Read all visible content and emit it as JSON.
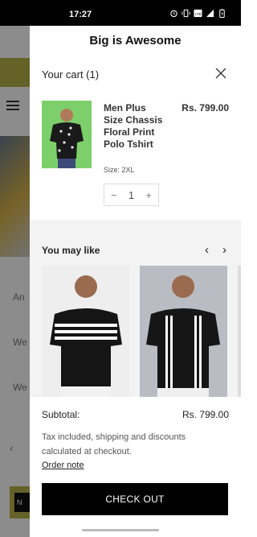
{
  "status_bar": {
    "time": "17:27"
  },
  "site": {
    "title": "Big is Awesome"
  },
  "background": {
    "lines": [
      "An",
      "We",
      "We"
    ],
    "prev_icon": "chevron-left-icon",
    "button_text": "N"
  },
  "cart": {
    "title": "Your cart (1)",
    "close_icon": "close-icon",
    "item": {
      "name": "Men Plus Size Chassis Floral Print Polo Tshirt",
      "price": "Rs. 799.00",
      "size": "Size: 2XL",
      "quantity": "1",
      "decrement": "−",
      "increment": "+"
    }
  },
  "recommendations": {
    "title": "You may like",
    "prev": "‹",
    "next": "›"
  },
  "summary": {
    "subtotal_label": "Subtotal:",
    "subtotal_value": "Rs. 799.00",
    "tax_note": "Tax included, shipping and discounts calculated at checkout.",
    "order_note": "Order note",
    "checkout_label": "CHECK OUT"
  },
  "colors": {
    "accent": "#b9b24a",
    "checkout_bg": "#000000",
    "product_bg": "#7ccf6a"
  }
}
